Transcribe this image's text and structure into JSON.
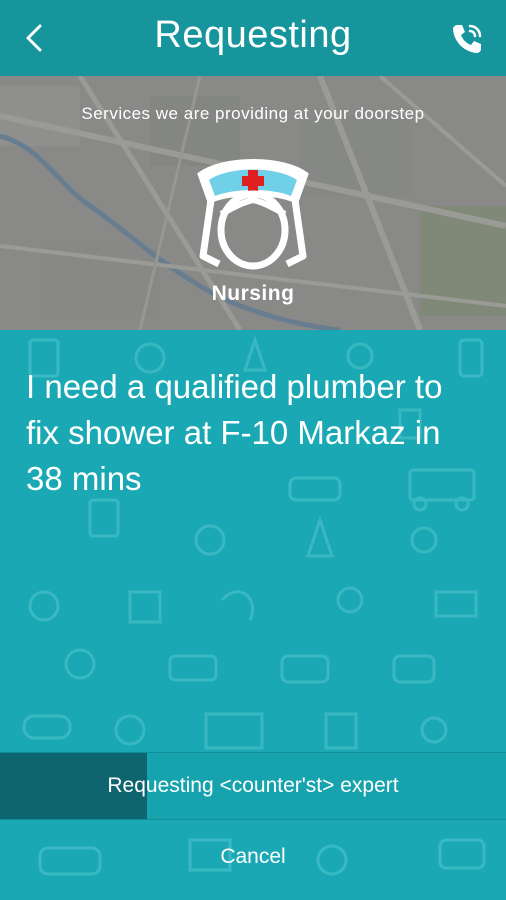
{
  "header": {
    "title": "Requesting",
    "back_icon": "chevron-left-icon",
    "call_icon": "phone-call-icon"
  },
  "map": {
    "tagline": "Services we are providing at your doorstep",
    "service_icon": "nurse-icon",
    "service_label": "Nursing"
  },
  "request": {
    "message": "I need a qualified plumber to fix shower at F-10 Markaz in 38 mins"
  },
  "progress": {
    "label": "Requesting <counter'st> expert",
    "fraction": 0.29
  },
  "actions": {
    "cancel_label": "Cancel"
  },
  "colors": {
    "header": "#16959d",
    "background": "#1aa9b4",
    "progress_fill": "#0e6570",
    "cross": "#e02020"
  }
}
